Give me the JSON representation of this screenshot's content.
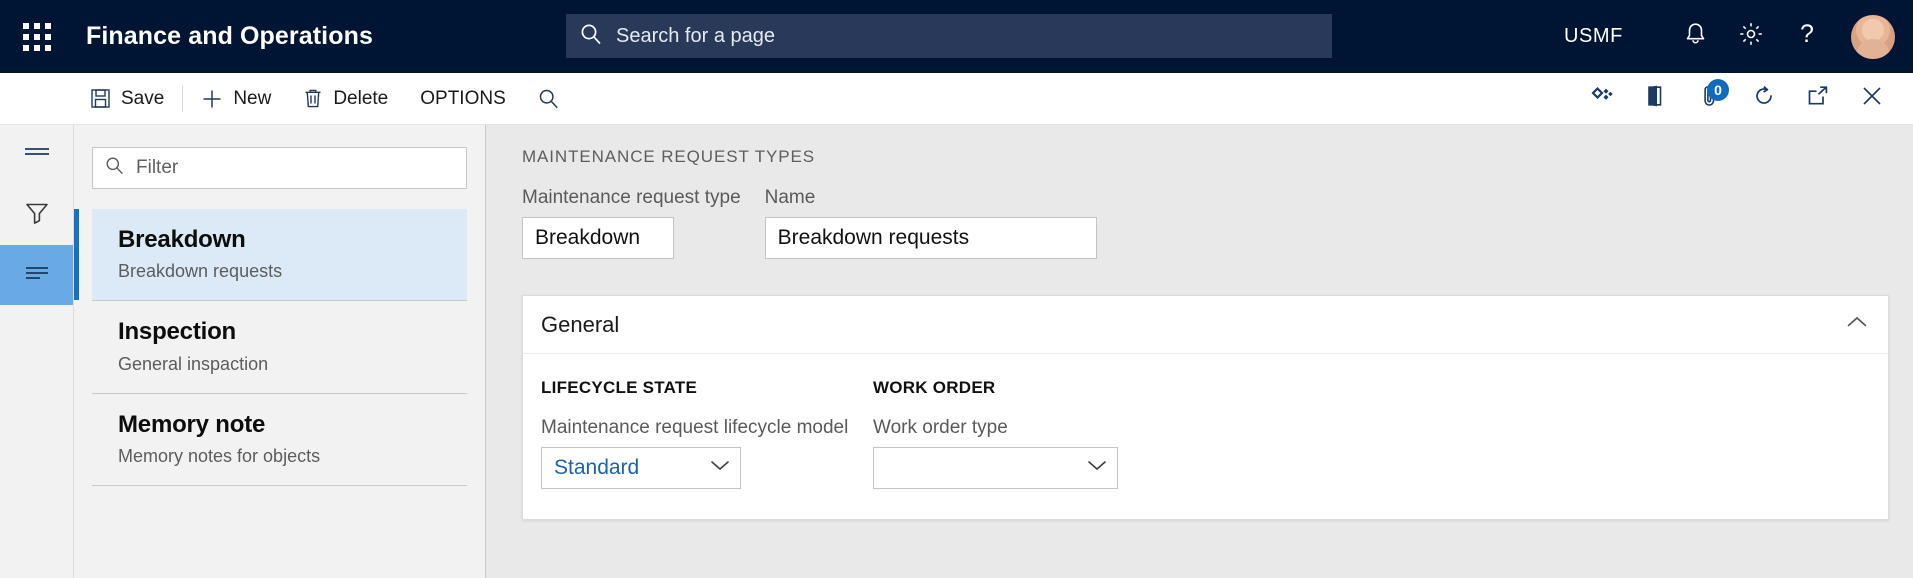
{
  "header": {
    "waffle_icon": "app-launcher-icon",
    "app_title": "Finance and Operations",
    "search": {
      "icon": "search-icon",
      "placeholder": "Search for a page",
      "value": ""
    },
    "company": "USMF",
    "notifications_icon": "bell-icon",
    "settings_icon": "gear-icon",
    "help_icon": "question-mark-icon",
    "avatar": "user-avatar"
  },
  "command_bar": {
    "save": {
      "label": "Save",
      "icon": "save-disk-icon"
    },
    "new": {
      "label": "New",
      "icon": "plus-icon"
    },
    "delete": {
      "label": "Delete",
      "icon": "trash-icon"
    },
    "options": {
      "label": "OPTIONS"
    },
    "search": {
      "icon": "search-icon"
    },
    "right_icons": [
      {
        "name": "related-information-icon"
      },
      {
        "name": "office-export-icon"
      },
      {
        "name": "attachments-icon",
        "badge": "0"
      },
      {
        "name": "refresh-icon"
      },
      {
        "name": "popout-icon"
      },
      {
        "name": "close-icon"
      }
    ]
  },
  "rail": {
    "items": [
      {
        "name": "navigation-menu-icon",
        "active": false
      },
      {
        "name": "filter-funnel-icon",
        "active": false
      },
      {
        "name": "list-view-icon",
        "active": true
      }
    ]
  },
  "list_pane": {
    "filter": {
      "icon": "search-icon",
      "placeholder": "Filter",
      "value": ""
    },
    "items": [
      {
        "title": "Breakdown",
        "subtitle": "Breakdown requests",
        "selected": true
      },
      {
        "title": "Inspection",
        "subtitle": "General inspaction",
        "selected": false
      },
      {
        "title": "Memory note",
        "subtitle": "Memory notes for objects",
        "selected": false
      }
    ]
  },
  "main": {
    "caption": "MAINTENANCE REQUEST TYPES",
    "fields": {
      "request_type": {
        "label": "Maintenance request type",
        "value": "Breakdown"
      },
      "name": {
        "label": "Name",
        "value": "Breakdown requests"
      }
    },
    "panel": {
      "title": "General",
      "collapse_icon": "chevron-up-icon",
      "groups": [
        {
          "heading": "LIFECYCLE STATE",
          "field": {
            "label": "Maintenance request lifecycle model",
            "value": "Standard",
            "icon": "chevron-down-icon"
          }
        },
        {
          "heading": "WORK ORDER",
          "field": {
            "label": "Work order type",
            "value": "",
            "icon": "chevron-down-icon"
          }
        }
      ]
    }
  },
  "colors": {
    "brand_navy": "#001433",
    "accent_blue": "#0f6cbd",
    "selected_row": "#dceaf7",
    "selection_bar": "#1573c4",
    "rail_active": "#6aaae4",
    "link_blue": "#1a62ad"
  }
}
